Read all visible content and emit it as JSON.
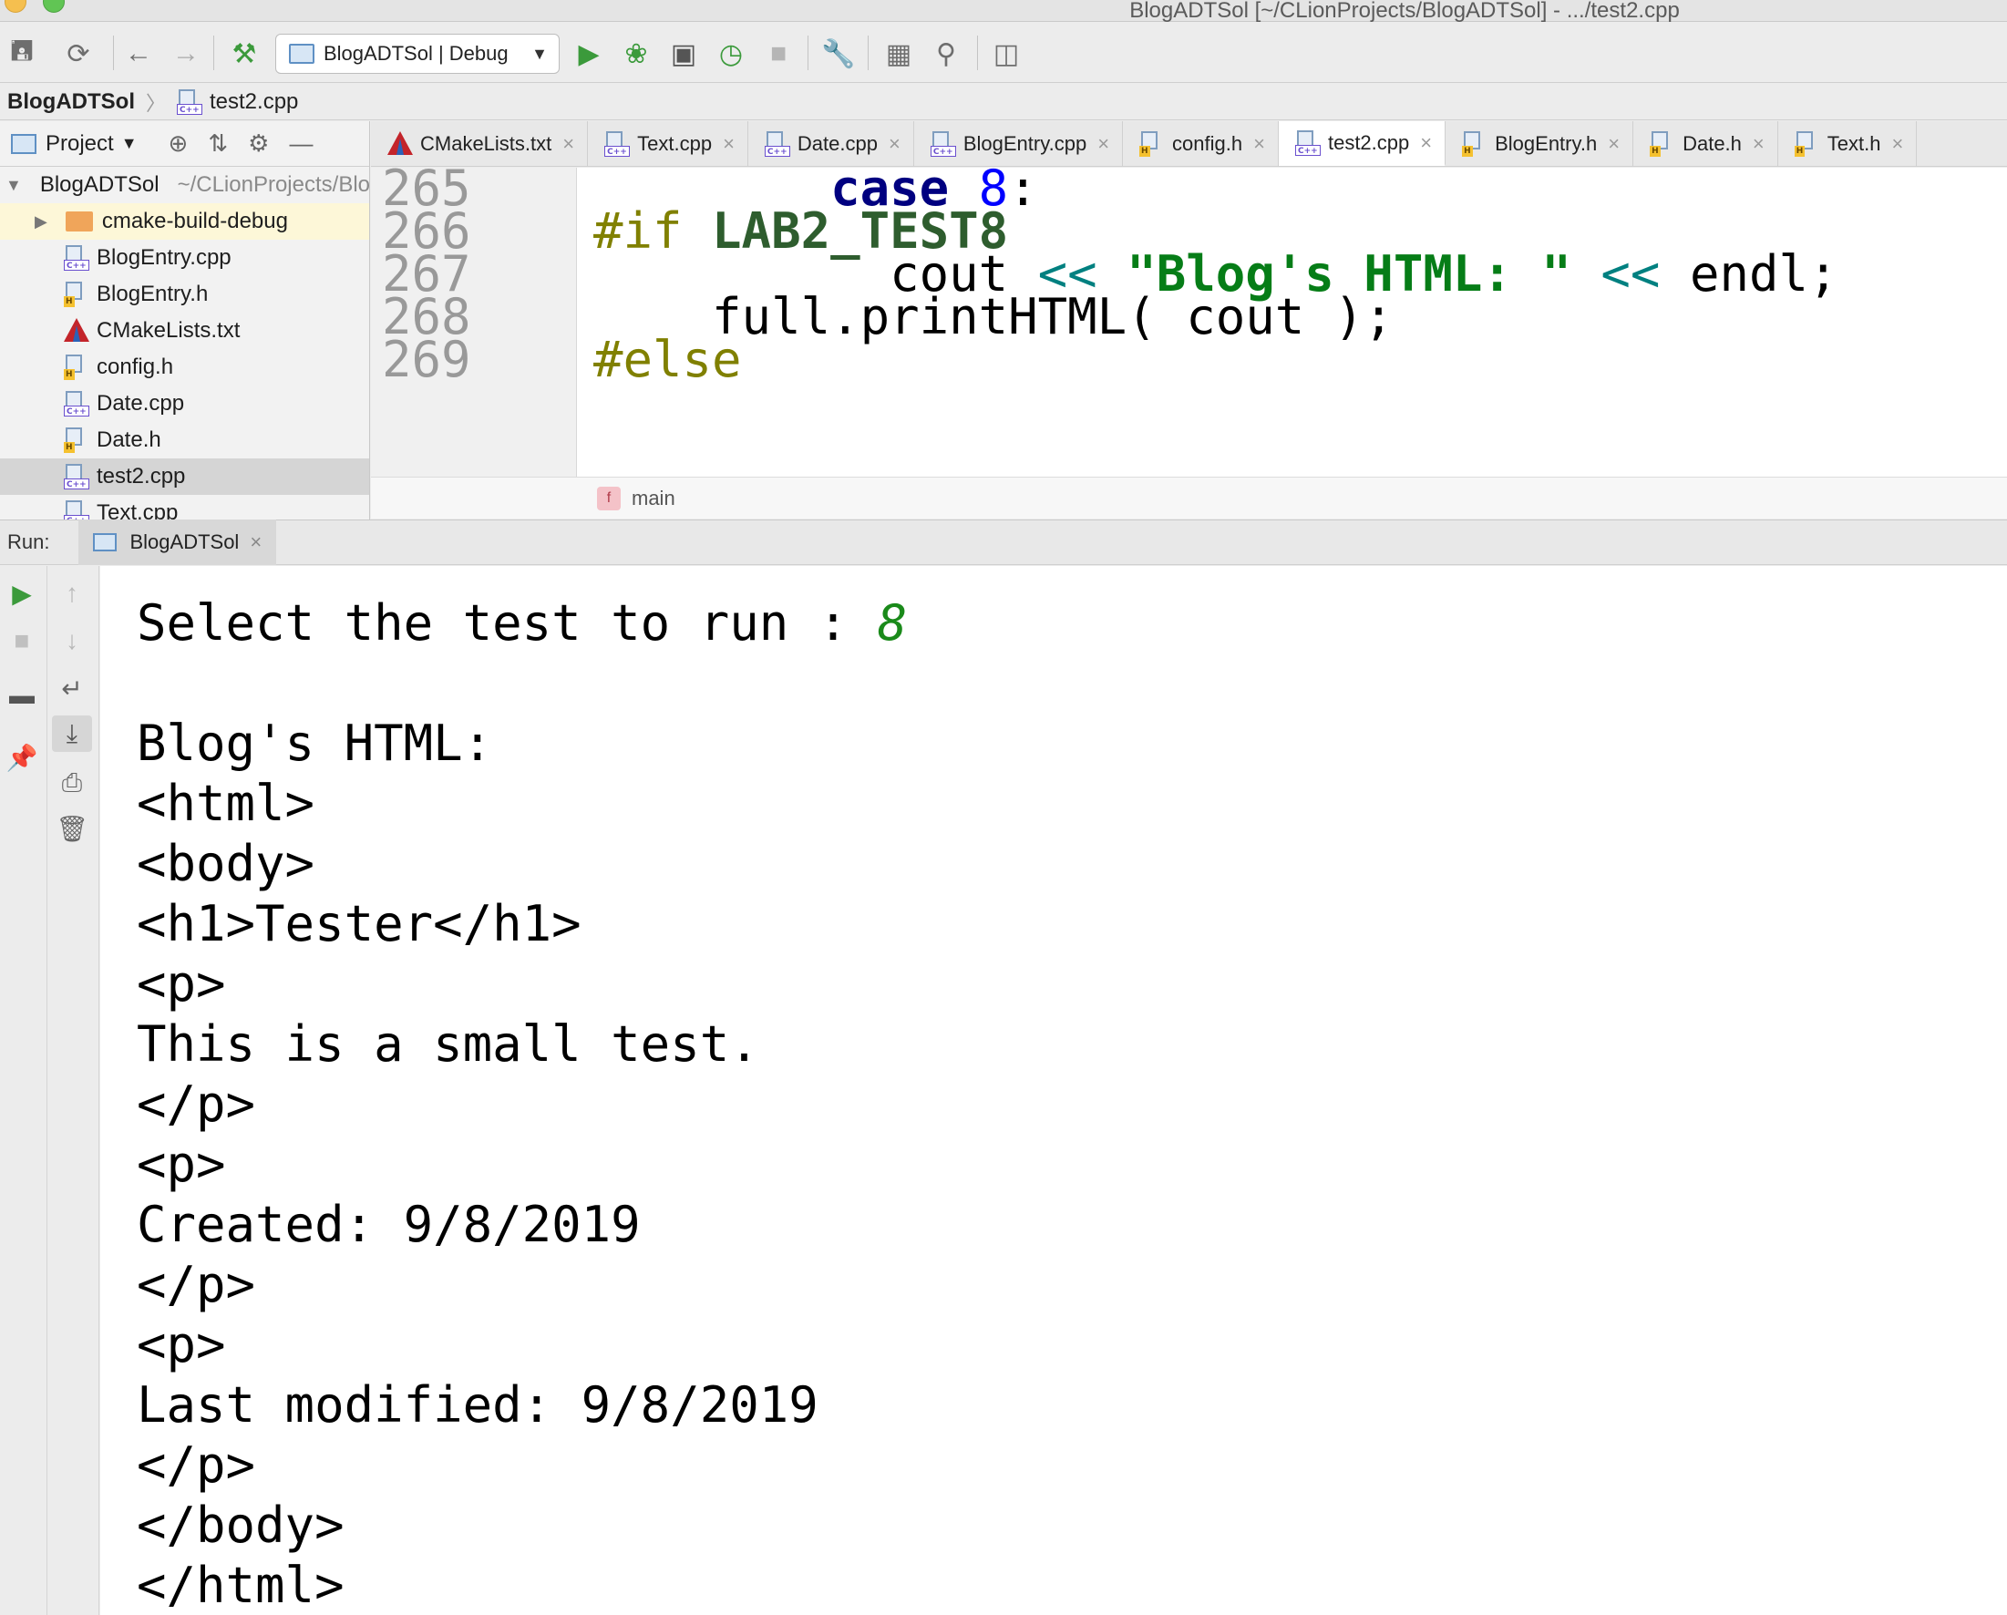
{
  "window": {
    "title": "BlogADTSol [~/CLionProjects/BlogADTSol] - .../test2.cpp"
  },
  "toolbar": {
    "run_config": "BlogADTSol | Debug",
    "icons": [
      "save-icon",
      "sync-icon",
      "back-icon",
      "forward-icon",
      "build-icon",
      "run-icon",
      "debug-icon",
      "run-coverage-icon",
      "profile-icon",
      "stop-icon",
      "settings-wrench-icon",
      "terminal-icon",
      "search-icon",
      "structure-icon"
    ]
  },
  "breadcrumb": {
    "project": "BlogADTSol",
    "file": "test2.cpp"
  },
  "project_panel": {
    "title": "Project",
    "root": {
      "name": "BlogADTSol",
      "path": "~/CLionProjects/BlogADTSol"
    },
    "folder": "cmake-build-debug",
    "files": [
      {
        "name": "BlogEntry.cpp",
        "type": "cpp"
      },
      {
        "name": "BlogEntry.h",
        "type": "h"
      },
      {
        "name": "CMakeLists.txt",
        "type": "cmake"
      },
      {
        "name": "config.h",
        "type": "h"
      },
      {
        "name": "Date.cpp",
        "type": "cpp"
      },
      {
        "name": "Date.h",
        "type": "h"
      },
      {
        "name": "test2.cpp",
        "type": "cpp",
        "selected": true
      },
      {
        "name": "Text.cpp",
        "type": "cpp"
      }
    ]
  },
  "tabs": [
    {
      "label": "CMakeLists.txt",
      "type": "cmake"
    },
    {
      "label": "Text.cpp",
      "type": "cpp"
    },
    {
      "label": "Date.cpp",
      "type": "cpp"
    },
    {
      "label": "BlogEntry.cpp",
      "type": "cpp"
    },
    {
      "label": "config.h",
      "type": "h"
    },
    {
      "label": "test2.cpp",
      "type": "cpp",
      "active": true
    },
    {
      "label": "BlogEntry.h",
      "type": "h"
    },
    {
      "label": "Date.h",
      "type": "h"
    },
    {
      "label": "Text.h",
      "type": "h"
    }
  ],
  "editor": {
    "line_numbers": [
      "265",
      "266",
      "267",
      "268",
      "269"
    ],
    "lines": [
      {
        "indent": "        ",
        "parts": [
          {
            "t": "case",
            "c": "kw"
          },
          {
            "t": " "
          },
          {
            "t": "8",
            "c": "num"
          },
          {
            "t": ":"
          }
        ]
      },
      {
        "indent": "",
        "parts": [
          {
            "t": "#if ",
            "c": "pp"
          },
          {
            "t": "LAB2_TEST8",
            "c": "macro"
          }
        ]
      },
      {
        "indent": "          ",
        "parts": [
          {
            "t": "cout "
          },
          {
            "t": "<<",
            "c": "op"
          },
          {
            "t": " "
          },
          {
            "t": "\"Blog's HTML: \"",
            "c": "str"
          },
          {
            "t": " "
          },
          {
            "t": "<<",
            "c": "op"
          },
          {
            "t": " endl;"
          }
        ]
      },
      {
        "indent": "    ",
        "parts": [
          {
            "t": "full.printHTML( cout );"
          }
        ]
      },
      {
        "indent": "",
        "parts": [
          {
            "t": "#else",
            "c": "pp"
          }
        ]
      }
    ],
    "function_crumb": "main"
  },
  "run": {
    "label": "Run:",
    "tab": "BlogADTSol",
    "prompt": "Select the test to run : ",
    "input_value": "8",
    "output_lines": [
      "",
      "Blog's HTML:",
      "<html>",
      "<body>",
      "<h1>Tester</h1>",
      "<p>",
      "This is a small test.",
      "</p>",
      "<p>",
      "Created: 9/8/2019",
      "</p>",
      "<p>",
      "Last modified: 9/8/2019",
      "</p>",
      "</body>",
      "</html>"
    ]
  }
}
